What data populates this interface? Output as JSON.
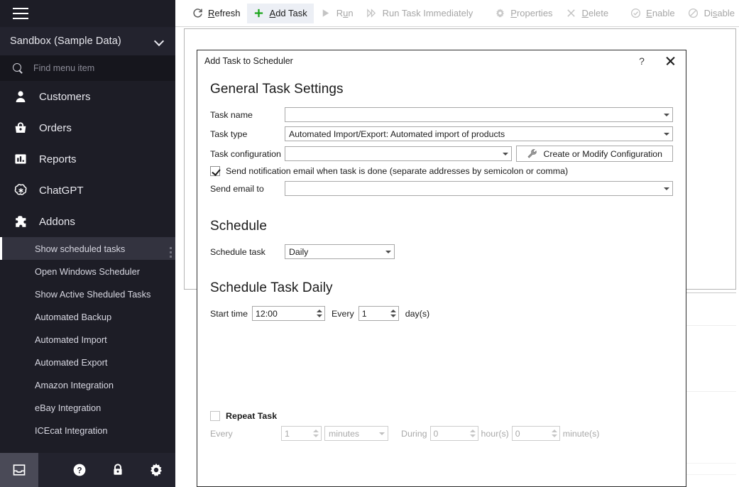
{
  "sidebar": {
    "hamburger_name": "menu-toggle",
    "database": "Sandbox (Sample Data)",
    "search_placeholder": "Find menu item",
    "nav": [
      {
        "label": "Customers",
        "icon": "user-icon"
      },
      {
        "label": "Orders",
        "icon": "basket-icon"
      },
      {
        "label": "Reports",
        "icon": "bar-chart-icon"
      },
      {
        "label": "ChatGPT",
        "icon": "chatgpt-icon"
      },
      {
        "label": "Addons",
        "icon": "puzzle-icon"
      }
    ],
    "subitems": [
      {
        "label": "Show scheduled tasks",
        "active": true
      },
      {
        "label": "Open Windows Scheduler",
        "active": false
      },
      {
        "label": "Show Active Sheduled Tasks",
        "active": false
      },
      {
        "label": "Automated Backup",
        "active": false
      },
      {
        "label": "Automated Import",
        "active": false
      },
      {
        "label": "Automated Export",
        "active": false
      },
      {
        "label": "Amazon Integration",
        "active": false
      },
      {
        "label": "eBay Integration",
        "active": false
      },
      {
        "label": "ICEcat Integration",
        "active": false
      }
    ],
    "bottom_buttons": [
      {
        "name": "inbox-icon",
        "selected": true
      },
      {
        "name": "help-icon",
        "selected": false
      },
      {
        "name": "lock-icon",
        "selected": false
      },
      {
        "name": "gear-icon",
        "selected": false
      }
    ]
  },
  "toolbar": {
    "refresh": {
      "label": "Refresh",
      "accel": "R",
      "rest": "efresh",
      "icon": "refresh-icon",
      "disabled": false,
      "active": false
    },
    "add_task": {
      "label": "Add Task",
      "accel": "A",
      "rest": "dd Task",
      "icon": "plus-icon",
      "disabled": false,
      "active": true
    },
    "run": {
      "label": "Run",
      "pre": "R",
      "accel": "u",
      "rest": "n",
      "icon": "play-icon",
      "disabled": true,
      "active": false
    },
    "run_now": {
      "label": "Run Task Immediately",
      "icon": "fast-forward-icon",
      "disabled": true,
      "active": false
    },
    "properties": {
      "label": "Properties",
      "accel": "P",
      "rest": "roperties",
      "icon": "gear-icon",
      "disabled": true,
      "active": false
    },
    "delete": {
      "label": "Delete",
      "accel": "D",
      "rest": "elete",
      "icon": "x-icon",
      "disabled": true,
      "active": false
    },
    "enable": {
      "label": "Enable",
      "accel": "E",
      "rest": "nable",
      "icon": "check-circle-icon",
      "disabled": true,
      "active": false
    },
    "disable": {
      "label": "Disable",
      "pre": "Di",
      "accel": "s",
      "rest": "able",
      "icon": "ban-circle-icon",
      "disabled": true,
      "active": false
    }
  },
  "dialog": {
    "title": "Add Task to Scheduler",
    "help_glyph": "?",
    "sections": {
      "general": "General Task Settings",
      "schedule": "Schedule",
      "schedule_daily": "Schedule Task Daily"
    },
    "fields": {
      "task_name": {
        "label": "Task name",
        "value": ""
      },
      "task_type": {
        "label": "Task type",
        "value": "Automated Import/Export: Automated import of products"
      },
      "task_configuration": {
        "label": "Task configuration",
        "value": ""
      },
      "config_button": {
        "label": "Create or Modify Configuration",
        "icon": "wrench-icon"
      },
      "notify": {
        "label": "Send notification email when task is done (separate addresses by semicolon or comma)",
        "checked": true
      },
      "send_email_to": {
        "label": "Send email to",
        "value": ""
      },
      "schedule_task": {
        "label": "Schedule task",
        "value": "Daily"
      },
      "start_time": {
        "label": "Start time",
        "value": "12:00"
      },
      "every_days": {
        "label": "Every",
        "value": "1",
        "suffix": "day(s)"
      }
    },
    "repeat": {
      "title": "Repeat Task",
      "checked": false,
      "every_label": "Every",
      "every_value": "1",
      "unit_value": "minutes",
      "during_label": "During",
      "hours_value": "0",
      "hours_suffix": "hour(s)",
      "minutes_value": "0",
      "minutes_suffix": "minute(s)"
    }
  },
  "colors": {
    "sidebar_bg": "#1d1d26",
    "sidebar_sub_active": "#33333f",
    "accent_green": "#1aa51a",
    "toolbar_active": "#eceff5"
  }
}
